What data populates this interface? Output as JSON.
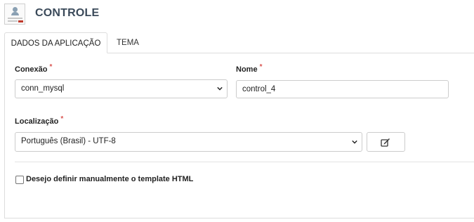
{
  "header": {
    "title": "CONTROLE",
    "icon": "form-icon"
  },
  "tabs": [
    {
      "label": "DADOS DA APLICAÇÃO",
      "active": true
    },
    {
      "label": "TEMA",
      "active": false
    }
  ],
  "form": {
    "connection": {
      "label": "Conexão",
      "required_mark": "*",
      "value": "conn_mysql"
    },
    "name": {
      "label": "Nome",
      "required_mark": "*",
      "value": "control_4"
    },
    "locale": {
      "label": "Localização",
      "required_mark": "*",
      "value": "Português (Brasil) - UTF-8"
    },
    "edit_button": {
      "icon": "edit-icon"
    },
    "manual_template": {
      "label": "Desejo definir manualmente o template HTML",
      "checked": false
    }
  },
  "colors": {
    "required": "#d9534f",
    "title": "#3b4a5a",
    "border": "#cccccc"
  }
}
